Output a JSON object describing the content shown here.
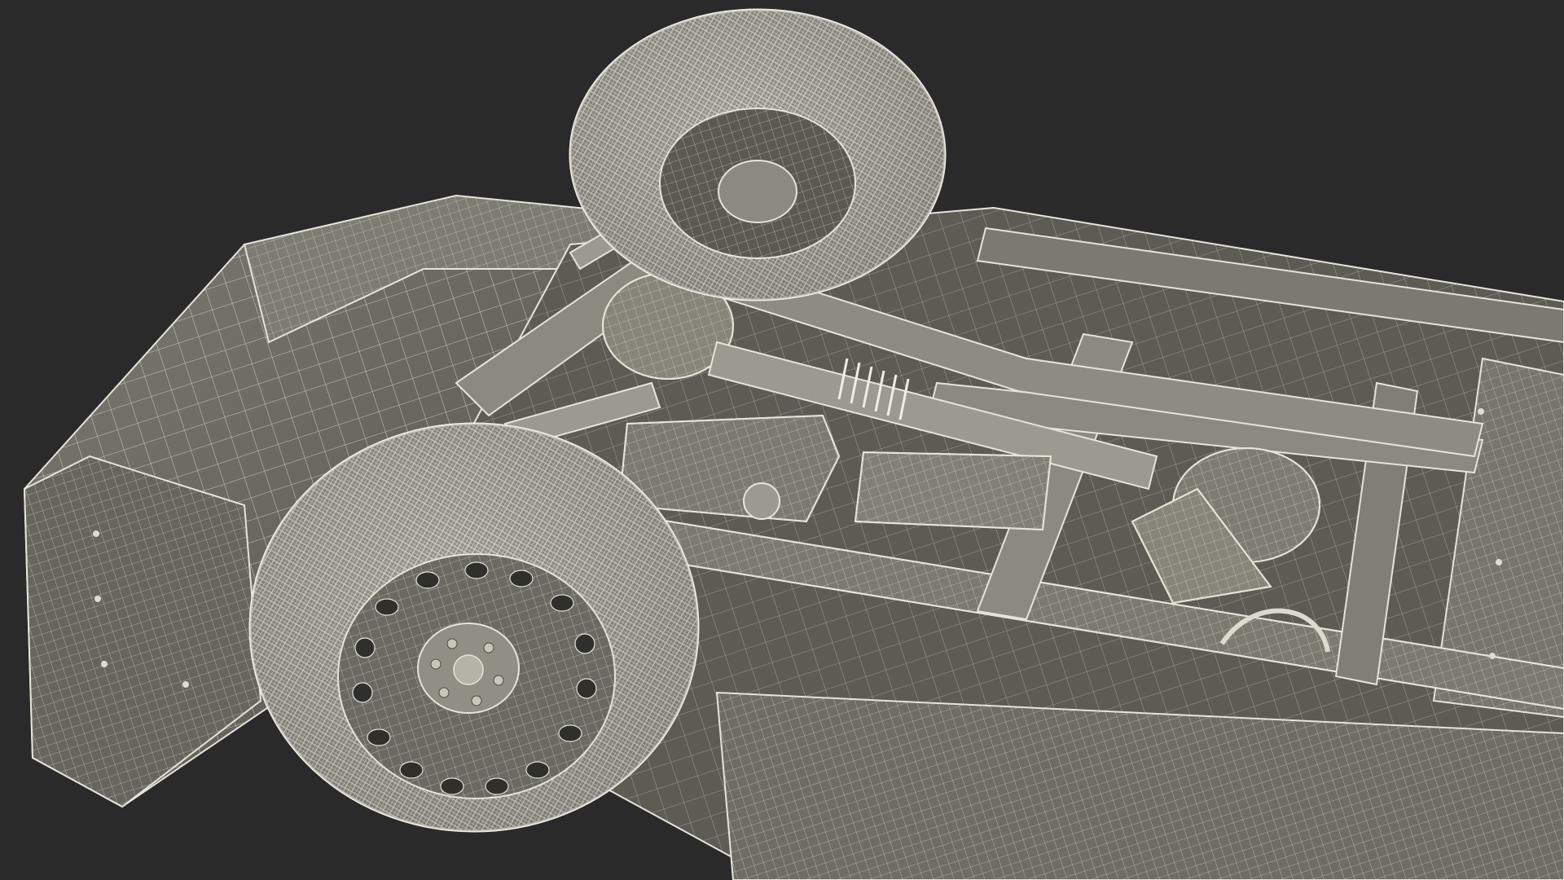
{
  "scene": {
    "subject": "3d-wireframe-vehicle-underside",
    "background_color": "#2a2a2a",
    "surface_color": "#6f6f66",
    "surface_dark_color": "#4a4a44",
    "surface_light_color": "#8a8a80",
    "wire_color": "#e6e4da",
    "tire_color": "#8c8b82",
    "shadow_color": "#1e1e1e"
  }
}
